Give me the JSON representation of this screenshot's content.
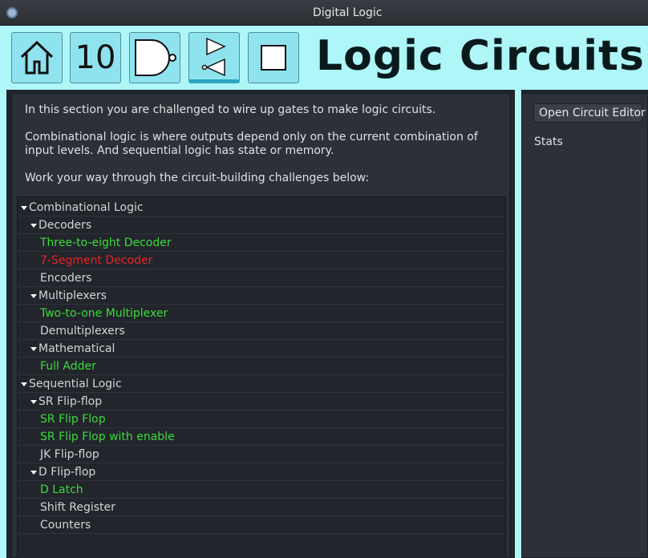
{
  "window": {
    "title": "Digital Logic"
  },
  "toolbar": {
    "tools": [
      {
        "name": "home-icon",
        "label": ""
      },
      {
        "name": "number-ten",
        "label": "10"
      },
      {
        "name": "nand-gate-icon",
        "label": ""
      },
      {
        "name": "buffer-gates-icon",
        "label": ""
      },
      {
        "name": "square-icon",
        "label": ""
      }
    ],
    "title": "Logic Circuits"
  },
  "intro": {
    "p1": "In this section you are challenged to wire up gates to make logic circuits.",
    "p2": "Combinational logic is where outputs depend only on the current combination of input levels. And sequential logic has state or memory.",
    "p3": "Work your way through the circuit-building challenges  below:"
  },
  "tree": [
    {
      "label": "Combinational Logic",
      "expanded": true,
      "status": "none"
    },
    {
      "label": "Decoders",
      "expanded": true,
      "status": "none"
    },
    {
      "label": "Three-to-eight Decoder",
      "status": "complete"
    },
    {
      "label": "7-Segment Decoder",
      "status": "failed"
    },
    {
      "label": "Encoders",
      "status": "none"
    },
    {
      "label": "Multiplexers",
      "expanded": true,
      "status": "none"
    },
    {
      "label": "Two-to-one Multiplexer",
      "status": "complete"
    },
    {
      "label": "Demultiplexers",
      "status": "none"
    },
    {
      "label": "Mathematical",
      "expanded": true,
      "status": "none"
    },
    {
      "label": "Full Adder",
      "status": "complete"
    },
    {
      "label": "Sequential Logic",
      "expanded": true,
      "status": "none"
    },
    {
      "label": "SR Flip-flop",
      "expanded": true,
      "status": "none"
    },
    {
      "label": "SR Flip Flop",
      "status": "complete"
    },
    {
      "label": "SR Flip Flop with enable",
      "status": "complete"
    },
    {
      "label": "JK Flip-flop",
      "status": "none"
    },
    {
      "label": "D Flip-flop",
      "expanded": true,
      "status": "none"
    },
    {
      "label": "D Latch",
      "status": "complete"
    },
    {
      "label": "Shift Register",
      "status": "none"
    },
    {
      "label": "Counters",
      "status": "none"
    }
  ],
  "side": {
    "open_editor": "Open Circuit Editor",
    "stats": "Stats"
  },
  "colors": {
    "header_bg": "#aef6f7",
    "complete": "#3bdc3b",
    "failed": "#e62424"
  }
}
